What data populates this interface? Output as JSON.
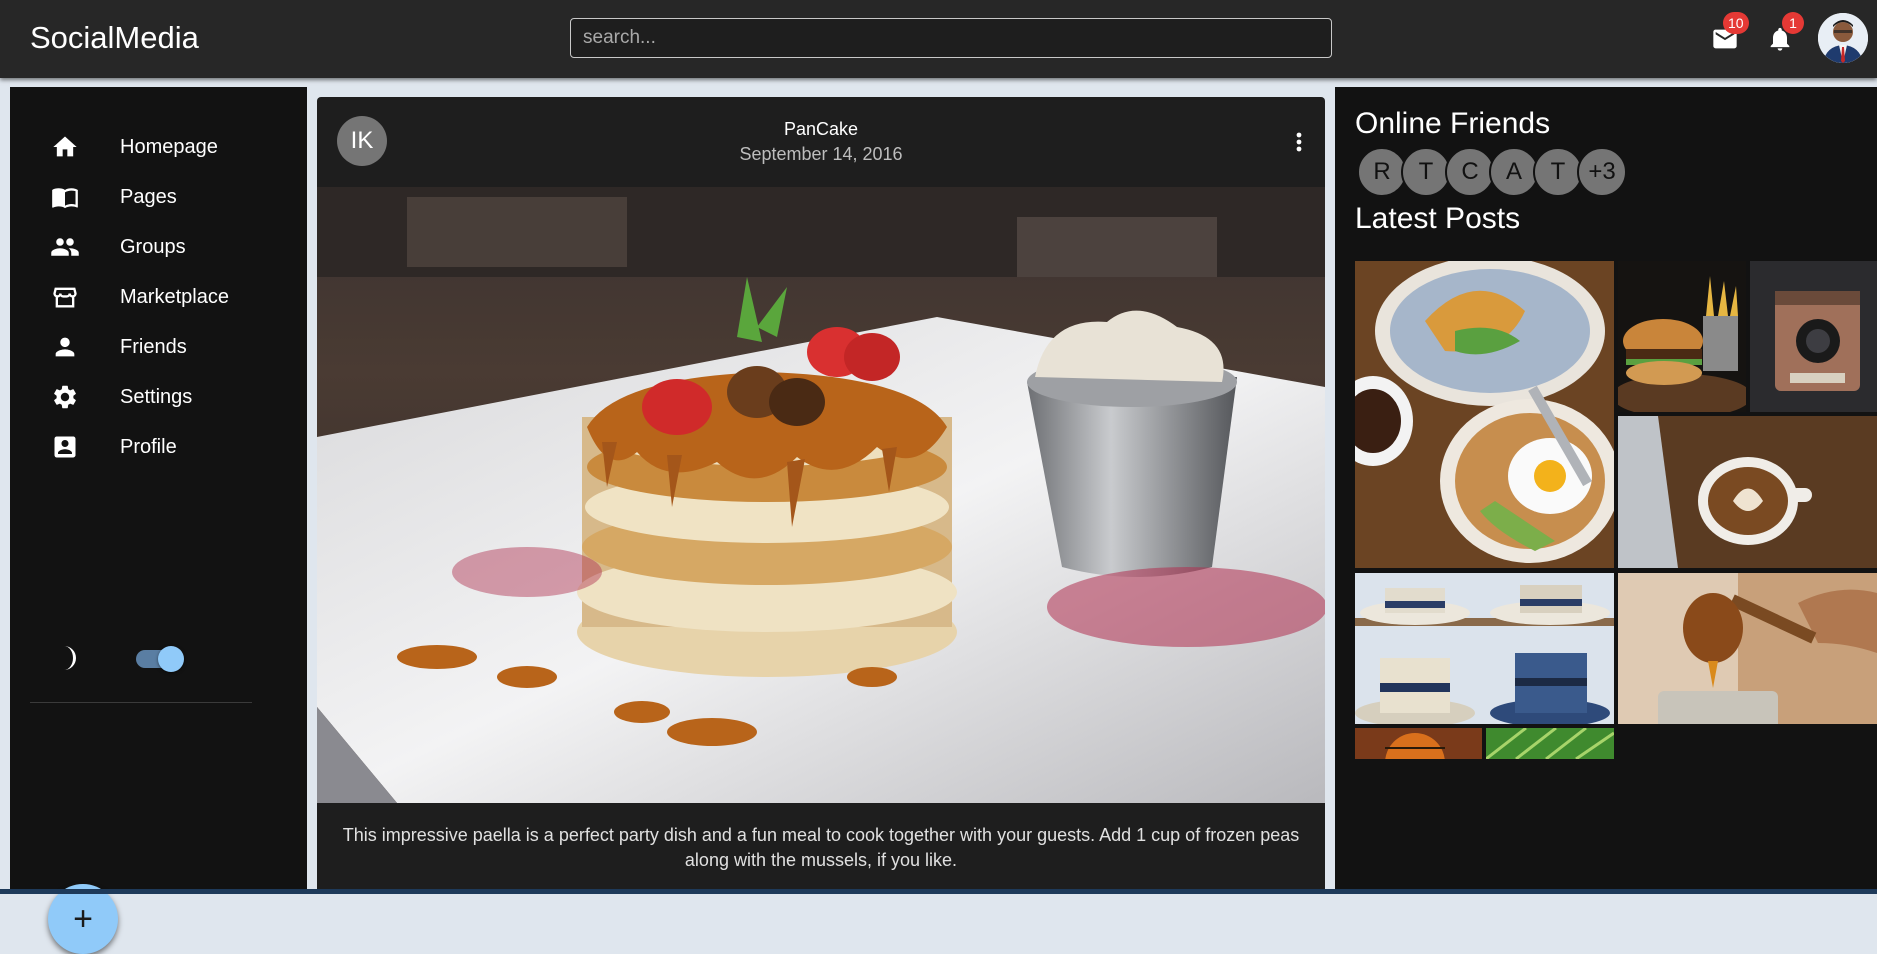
{
  "app": {
    "title": "SocialMedia"
  },
  "search": {
    "placeholder": "search..."
  },
  "header": {
    "mail_badge": "10",
    "notification_badge": "1"
  },
  "sidebar": {
    "items": [
      {
        "label": "Homepage",
        "icon": "home-icon"
      },
      {
        "label": "Pages",
        "icon": "book-icon"
      },
      {
        "label": "Groups",
        "icon": "group-icon"
      },
      {
        "label": "Marketplace",
        "icon": "storefront-icon"
      },
      {
        "label": "Friends",
        "icon": "person-icon"
      },
      {
        "label": "Settings",
        "icon": "gear-icon"
      },
      {
        "label": "Profile",
        "icon": "account-box-icon"
      }
    ],
    "dark_mode_on": true,
    "fab_label": "+"
  },
  "post": {
    "avatar_initials": "IK",
    "title": "PanCake",
    "date": "September 14, 2016",
    "text": "This impressive paella is a perfect party dish and a fun meal to cook together with your guests. Add 1 cup of frozen peas along with the mussels, if you like."
  },
  "rightbar": {
    "online_title": "Online Friends",
    "friends": [
      "R",
      "T",
      "C",
      "A",
      "T"
    ],
    "friends_more": "+3",
    "latest_title": "Latest Posts"
  },
  "colors": {
    "appbar": "#272727",
    "sidebar": "#121212",
    "card": "#1e1e1e",
    "accent": "#90caf9",
    "badge": "#e53935"
  }
}
